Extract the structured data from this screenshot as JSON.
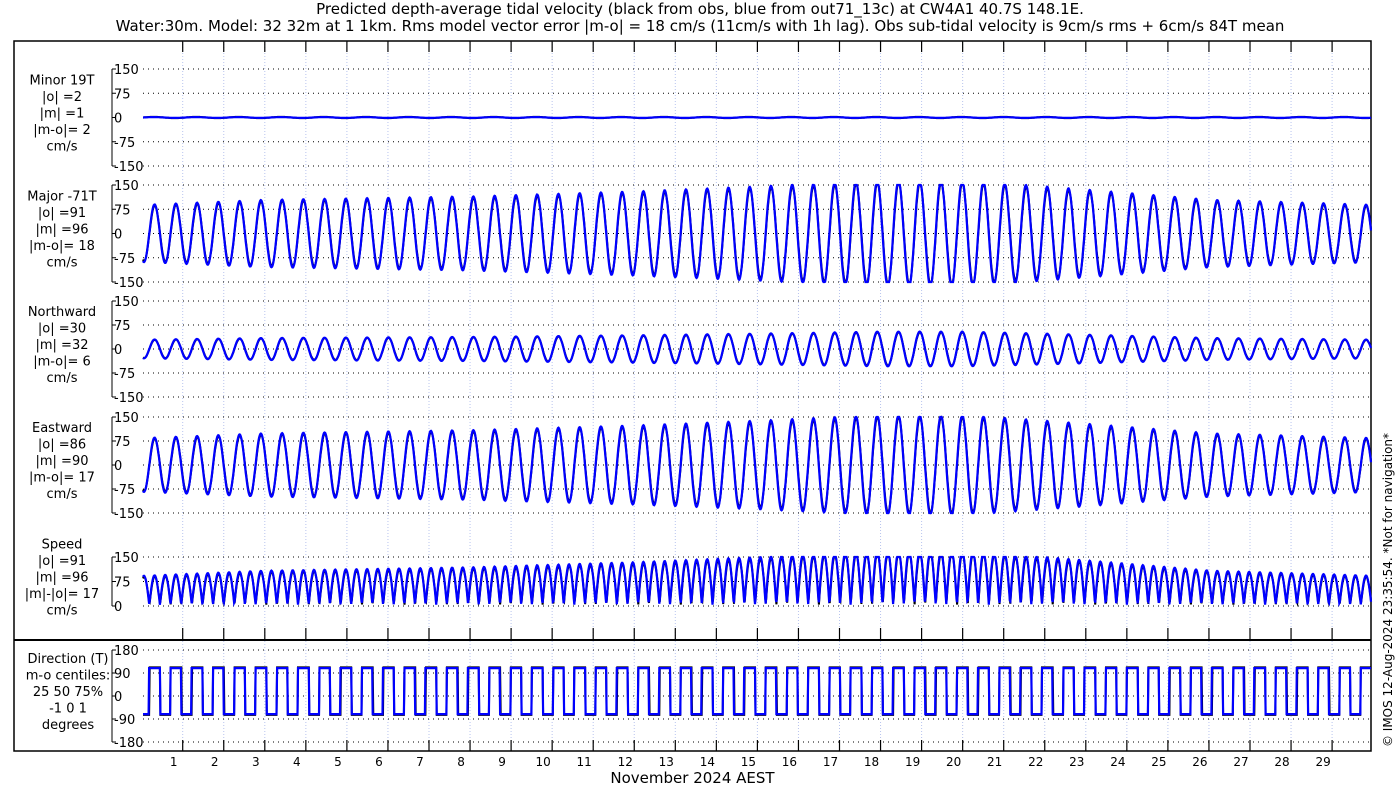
{
  "title_line1": "Predicted depth-average tidal velocity (black from obs, blue from out71_13c) at CW4A1 40.7S 148.1E.",
  "title_line2": "Water:30m. Model: 32 32m at 1 1km. Rms model vector error |m-o| = 18 cm/s (11cm/s with 1h lag). Obs sub-tidal velocity is 9cm/s rms + 6cm/s 84T mean",
  "watermark": "© IMOS 12-Aug-2024 23:35:54. *Not for navigation*",
  "chart_data": {
    "type": "line",
    "xlabel": "November 2024 AEST",
    "x_ticks": [
      "1",
      "2",
      "3",
      "4",
      "5",
      "6",
      "7",
      "8",
      "9",
      "10",
      "11",
      "12",
      "13",
      "14",
      "15",
      "16",
      "17",
      "18",
      "19",
      "20",
      "21",
      "22",
      "23",
      "24",
      "25",
      "26",
      "27",
      "28",
      "29"
    ],
    "x_range_days": [
      0,
      29.9
    ],
    "tidal_period_hours": 12.42,
    "amplitude_envelope": [
      [
        0,
        85
      ],
      [
        3,
        100
      ],
      [
        8,
        110
      ],
      [
        12,
        125
      ],
      [
        15,
        140
      ],
      [
        18,
        158
      ],
      [
        20,
        158
      ],
      [
        23,
        130
      ],
      [
        26,
        100
      ],
      [
        30,
        85
      ]
    ],
    "series_colors": {
      "obs": "#000000",
      "model": "#0000ff"
    },
    "panels": [
      {
        "id": "minor",
        "label": [
          "Minor 19T",
          "|o| =2",
          "|m| =1",
          "|m-o|= 2",
          "cm/s"
        ],
        "ylim": [
          -150,
          150
        ],
        "yticks": [
          "150",
          "75",
          "0",
          "-75",
          "-150"
        ],
        "scale": 0.02
      },
      {
        "id": "major",
        "label": [
          "Major -71T",
          "|o| =91",
          "|m| =96",
          "|m-o|= 18",
          "cm/s"
        ],
        "ylim": [
          -150,
          150
        ],
        "yticks": [
          "150",
          "75",
          "0",
          "-75",
          "-150"
        ],
        "scale": 1.0
      },
      {
        "id": "north",
        "label": [
          "Northward",
          "|o| =30",
          "|m| =32",
          "|m-o|= 6",
          "cm/s"
        ],
        "ylim": [
          -150,
          150
        ],
        "yticks": [
          "150",
          "75",
          "0",
          "-75",
          "-150"
        ],
        "scale": 0.33
      },
      {
        "id": "east",
        "label": [
          "Eastward",
          "|o| =86",
          "|m| =90",
          "|m-o|= 17",
          "cm/s"
        ],
        "ylim": [
          -150,
          150
        ],
        "yticks": [
          "150",
          "75",
          "0",
          "-75",
          "-150"
        ],
        "scale": 0.95
      },
      {
        "id": "speed",
        "label": [
          "Speed",
          "|o| =91",
          "|m| =96",
          "|m|-|o|= 17",
          "cm/s"
        ],
        "ylim": [
          0,
          150
        ],
        "yticks": [
          "150",
          "75",
          "0"
        ],
        "scale": 1.0
      },
      {
        "id": "direction",
        "label": [
          "Direction (T)",
          "m-o centiles:",
          "25  50  75%",
          "-1  0  1",
          "degrees"
        ],
        "ylim": [
          -180,
          180
        ],
        "yticks": [
          "180",
          "90",
          "0",
          "-90",
          "-180"
        ],
        "flood_dir": 109,
        "ebb_dir": -71
      }
    ]
  }
}
